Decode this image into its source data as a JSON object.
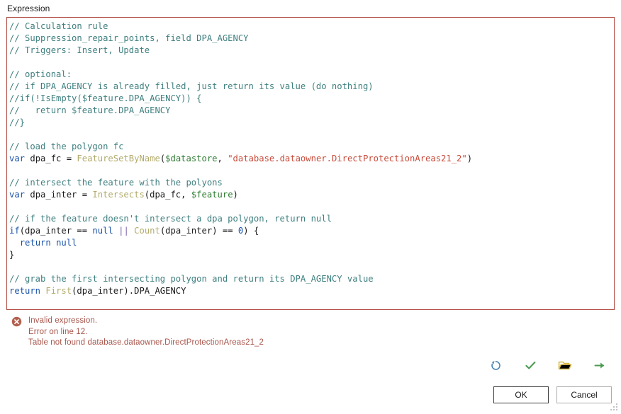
{
  "field": {
    "label": "Expression"
  },
  "editor": {
    "border_color": "#b04a42",
    "language": "Arcade",
    "lines": [
      [
        {
          "t": "// Calculation rule",
          "c": "c"
        }
      ],
      [
        {
          "t": "// Suppression_repair_points, field DPA_AGENCY",
          "c": "c"
        }
      ],
      [
        {
          "t": "// Triggers: Insert, Update",
          "c": "c"
        }
      ],
      [
        {
          "t": "",
          "c": "pl"
        }
      ],
      [
        {
          "t": "// optional:",
          "c": "c"
        }
      ],
      [
        {
          "t": "// if DPA_AGENCY is already filled, just return its value (do nothing)",
          "c": "c"
        }
      ],
      [
        {
          "t": "//if(!IsEmpty($feature.DPA_AGENCY)) {",
          "c": "c"
        }
      ],
      [
        {
          "t": "//   return $feature.DPA_AGENCY",
          "c": "c"
        }
      ],
      [
        {
          "t": "//}",
          "c": "c"
        }
      ],
      [
        {
          "t": "",
          "c": "pl"
        }
      ],
      [
        {
          "t": "// load the polygon fc",
          "c": "c"
        }
      ],
      [
        {
          "t": "var",
          "c": "kw"
        },
        {
          "t": " dpa_fc = ",
          "c": "pl"
        },
        {
          "t": "FeatureSetByName",
          "c": "fn"
        },
        {
          "t": "(",
          "c": "pl"
        },
        {
          "t": "$datastore",
          "c": "vr"
        },
        {
          "t": ", ",
          "c": "pl"
        },
        {
          "t": "\"database.dataowner.DirectProtectionAreas21_2\"",
          "c": "st"
        },
        {
          "t": ")",
          "c": "pl"
        }
      ],
      [
        {
          "t": "",
          "c": "pl"
        }
      ],
      [
        {
          "t": "// intersect the feature with the polyons",
          "c": "c"
        }
      ],
      [
        {
          "t": "var",
          "c": "kw"
        },
        {
          "t": " dpa_inter = ",
          "c": "pl"
        },
        {
          "t": "Intersects",
          "c": "fn"
        },
        {
          "t": "(dpa_fc, ",
          "c": "pl"
        },
        {
          "t": "$feature",
          "c": "vr"
        },
        {
          "t": ")",
          "c": "pl"
        }
      ],
      [
        {
          "t": "",
          "c": "pl"
        }
      ],
      [
        {
          "t": "// if the feature doesn't intersect a dpa polygon, return null",
          "c": "c"
        }
      ],
      [
        {
          "t": "if",
          "c": "kw"
        },
        {
          "t": "(dpa_inter == ",
          "c": "pl"
        },
        {
          "t": "null",
          "c": "kw"
        },
        {
          "t": " ",
          "c": "pl"
        },
        {
          "t": "||",
          "c": "op"
        },
        {
          "t": " ",
          "c": "pl"
        },
        {
          "t": "Count",
          "c": "fn"
        },
        {
          "t": "(dpa_inter) == ",
          "c": "pl"
        },
        {
          "t": "0",
          "c": "nm"
        },
        {
          "t": ") {",
          "c": "pl"
        }
      ],
      [
        {
          "t": "  ",
          "c": "pl"
        },
        {
          "t": "return",
          "c": "kw"
        },
        {
          "t": " ",
          "c": "pl"
        },
        {
          "t": "null",
          "c": "kw"
        }
      ],
      [
        {
          "t": "}",
          "c": "pl"
        }
      ],
      [
        {
          "t": "",
          "c": "pl"
        }
      ],
      [
        {
          "t": "// grab the first intersecting polygon and return its DPA_AGENCY value",
          "c": "c"
        }
      ],
      [
        {
          "t": "return",
          "c": "kw"
        },
        {
          "t": " ",
          "c": "pl"
        },
        {
          "t": "First",
          "c": "fn"
        },
        {
          "t": "(dpa_inter).DPA_AGENCY",
          "c": "pl"
        }
      ]
    ]
  },
  "error": {
    "icon": "error-circle-x-icon",
    "color": "#a8564c",
    "messages": [
      "Invalid expression.",
      "Error on line 12.",
      "Table not found database.dataowner.DirectProtectionAreas21_2"
    ]
  },
  "toolbar": {
    "icons": [
      {
        "name": "reset-icon",
        "title": "Reset",
        "color": "#4a86b8"
      },
      {
        "name": "verify-icon",
        "title": "Verify",
        "color": "#4c9a52"
      },
      {
        "name": "open-icon",
        "title": "Open",
        "color": "#d4b23c"
      },
      {
        "name": "run-icon",
        "title": "Run",
        "color": "#4c9a52"
      }
    ]
  },
  "buttons": {
    "ok": "OK",
    "cancel": "Cancel"
  },
  "window": {
    "resize_grip": "resize-grip"
  }
}
